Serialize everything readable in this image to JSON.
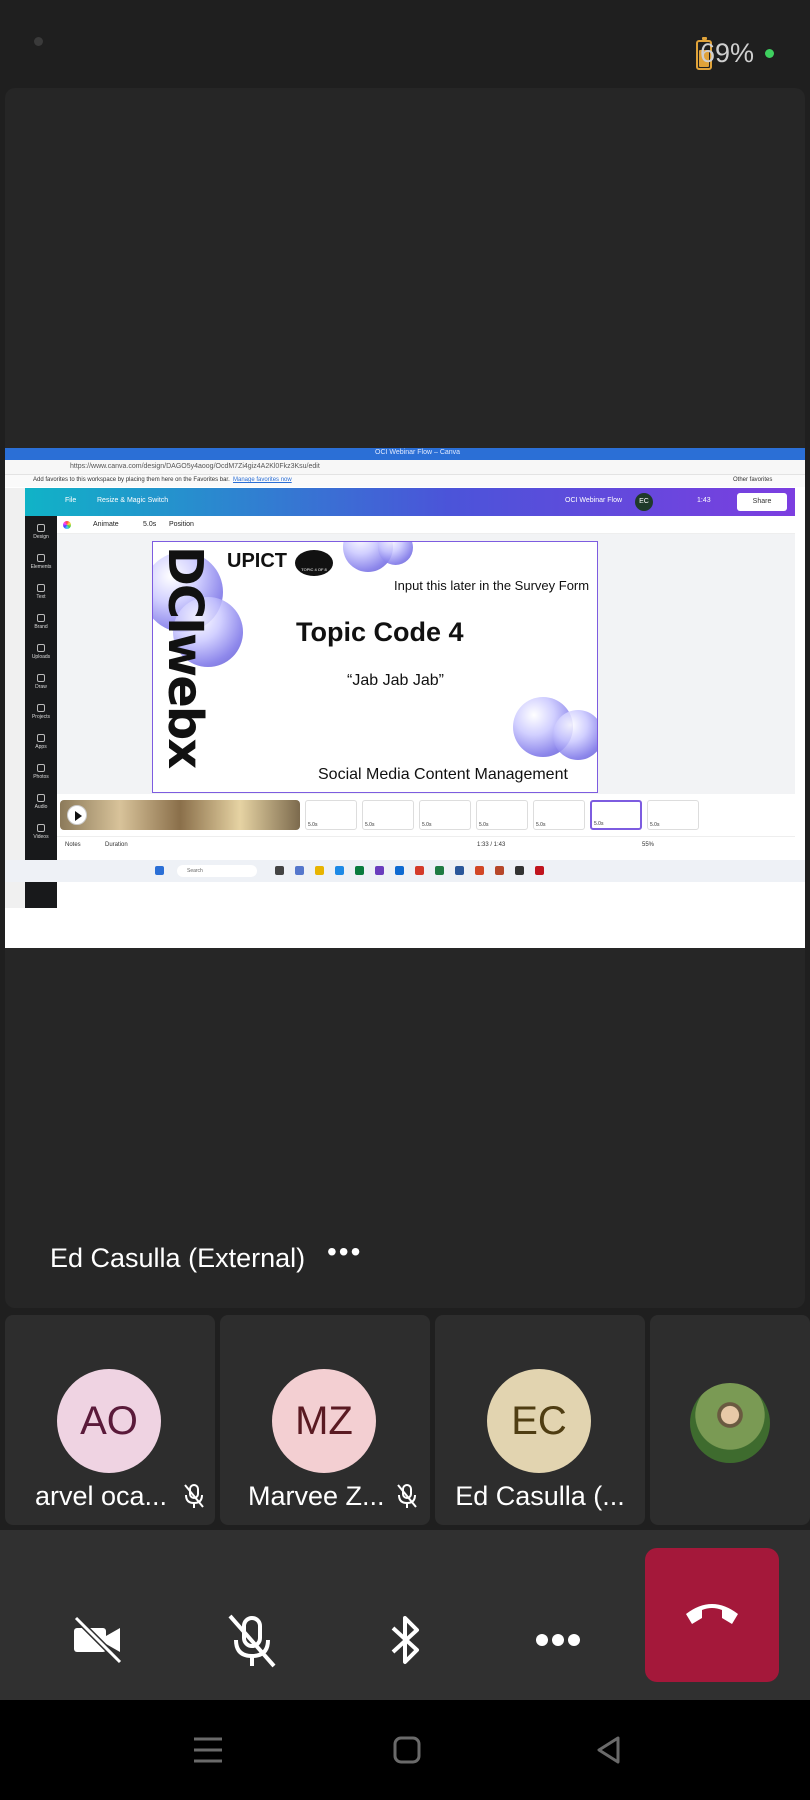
{
  "status": {
    "battery": "69%"
  },
  "presenter": {
    "name": "Ed Casulla (External)",
    "more": "•••"
  },
  "shared": {
    "window_title": "OCI Webinar Flow – Canva",
    "url": "https://www.canva.com/design/DAGO5y4aoog/OcdM7Zi4giz4A2Kl0Fkz3Ksu/edit",
    "favorites_hint": "Add favorites to this workspace by placing them here on the Favorites bar.",
    "favorites_link": "Manage favorites now",
    "other_favorites": "Other favorites",
    "canva": {
      "file": "File",
      "resize": "Resize & Magic Switch",
      "design_name": "OCI Webinar Flow",
      "user_initials": "EC",
      "duration": "1:43",
      "share": "Share",
      "sidebar": [
        "Design",
        "Elements",
        "Text",
        "Brand",
        "Uploads",
        "Draw",
        "Projects",
        "Apps",
        "Photos",
        "Audio",
        "Videos"
      ],
      "toolbar": {
        "animate": "Animate",
        "time": "5.0s",
        "position": "Position"
      },
      "footer": {
        "notes": "Notes",
        "duration": "Duration",
        "timecode": "1:33 / 1:43",
        "zoom": "55%"
      }
    },
    "slide": {
      "brand": "DCIwebx",
      "logo": "UPICT",
      "logo_badge": "TOPIC 4 OF 8",
      "input_note": "Input this later in the Survey Form",
      "topic": "Topic Code 4",
      "code": "“Jab Jab Jab”",
      "footer": "Social Media Content Management"
    },
    "timeline_thumbs": [
      "5.0s",
      "5.0s",
      "5.0s",
      "5.0s",
      "5.0s",
      "5.0s",
      "5.0s"
    ],
    "taskbar": {
      "search": "Search"
    }
  },
  "participants": [
    {
      "initials": "AO",
      "name": "arvel oca...",
      "avatar_bg": "#efd3e2",
      "avatar_fg": "#5a1a3a",
      "muted": true
    },
    {
      "initials": "MZ",
      "name": "Marvee Z...",
      "avatar_bg": "#f3cfd2",
      "avatar_fg": "#5a1a22",
      "muted": true
    },
    {
      "initials": "EC",
      "name": "Ed Casulla (...",
      "avatar_bg": "#e2d4b0",
      "avatar_fg": "#4f3d12",
      "muted": false
    }
  ],
  "controls": [
    "camera-off",
    "mic-off",
    "bluetooth",
    "more",
    "end-call"
  ],
  "colors": {
    "end_call": "#a4183a",
    "canva_gradient_start": "#10b3c7",
    "canva_gradient_end": "#7c3ee0",
    "slide_accent": "#7d5ce0"
  }
}
